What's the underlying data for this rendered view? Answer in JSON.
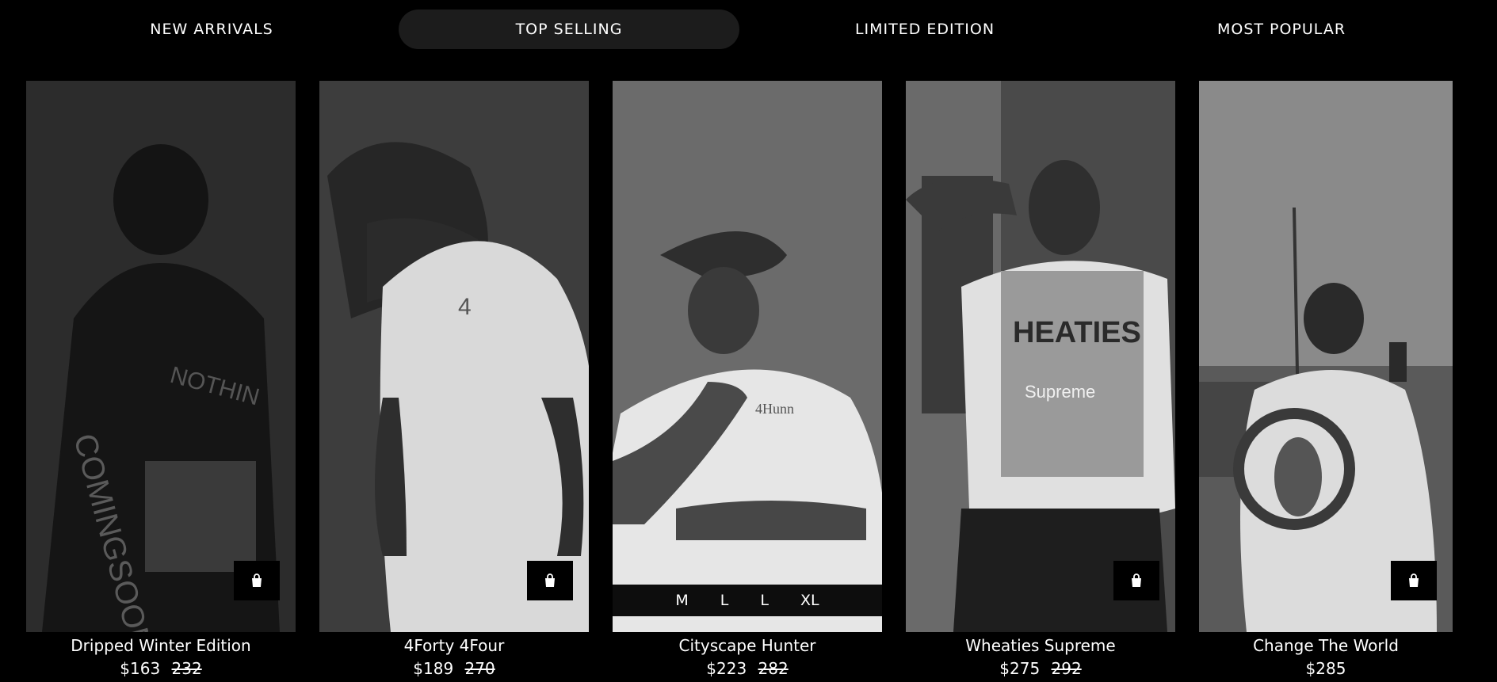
{
  "tabs": [
    {
      "label": "NEW ARRIVALS",
      "active": false
    },
    {
      "label": "TOP SELLING",
      "active": true
    },
    {
      "label": "LIMITED EDITION",
      "active": false
    },
    {
      "label": "MOST POPULAR",
      "active": false
    }
  ],
  "products": [
    {
      "name": "Dripped Winter Edition",
      "price": "$163",
      "old_price": "232",
      "has_cart": true,
      "sizes": []
    },
    {
      "name": "4Forty 4Four",
      "price": "$189",
      "old_price": "270",
      "has_cart": true,
      "sizes": []
    },
    {
      "name": "Cityscape Hunter",
      "price": "$223",
      "old_price": "282",
      "has_cart": false,
      "sizes": [
        "M",
        "L",
        "L",
        "XL"
      ]
    },
    {
      "name": "Wheaties Supreme",
      "price": "$275",
      "old_price": "292",
      "has_cart": true,
      "sizes": []
    },
    {
      "name": "Change The World",
      "price": "$285",
      "old_price": "",
      "has_cart": true,
      "sizes": []
    }
  ],
  "icons": {
    "cart": "shopping-bag-icon"
  },
  "colors": {
    "background": "#000000",
    "active_tab": "#1c1c1c",
    "text": "#ffffff"
  }
}
